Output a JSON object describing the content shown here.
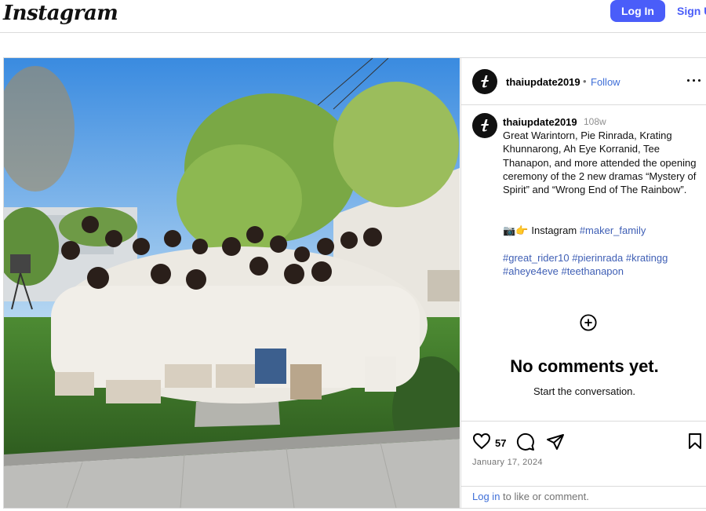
{
  "header": {
    "logo_text": "Instagram",
    "login_label": "Log In",
    "signup_label": "Sign Up"
  },
  "post": {
    "author": "thaiupdate2019",
    "follow_label": "Follow",
    "separator": "•",
    "caption": {
      "username": "thaiupdate2019",
      "time_ago": "108w",
      "text": "Great Warintorn, Pie Rinrada, Krating Khunnarong, Ah Eye Korranid, Tee Thanapon, and more attended the opening ceremony of the 2 new dramas “Mystery of Spirit” and “Wrong End of The Rainbow”.",
      "line2_emoji": "📷👉",
      "line2_text": "Instagram",
      "line2_tag": "#maker_family",
      "tags": [
        "#great_rider10",
        "#pierinrada",
        "#kratingg",
        "#aheye4eve",
        "#teethanapon"
      ]
    },
    "comments": {
      "empty_title": "No comments yet.",
      "empty_subtitle": "Start the conversation."
    },
    "likes_count": "57",
    "date": "January 17, 2024",
    "login_prompt": {
      "link": "Log in",
      "text": " to like or comment."
    }
  },
  "colors": {
    "accent": "#4a5df9",
    "link": "#3f6fd8",
    "border": "#dbdbdb"
  },
  "icons": [
    "more-options-icon",
    "add-circle-icon",
    "heart-icon",
    "comment-icon",
    "share-icon",
    "bookmark-icon",
    "avatar-logo-icon"
  ]
}
